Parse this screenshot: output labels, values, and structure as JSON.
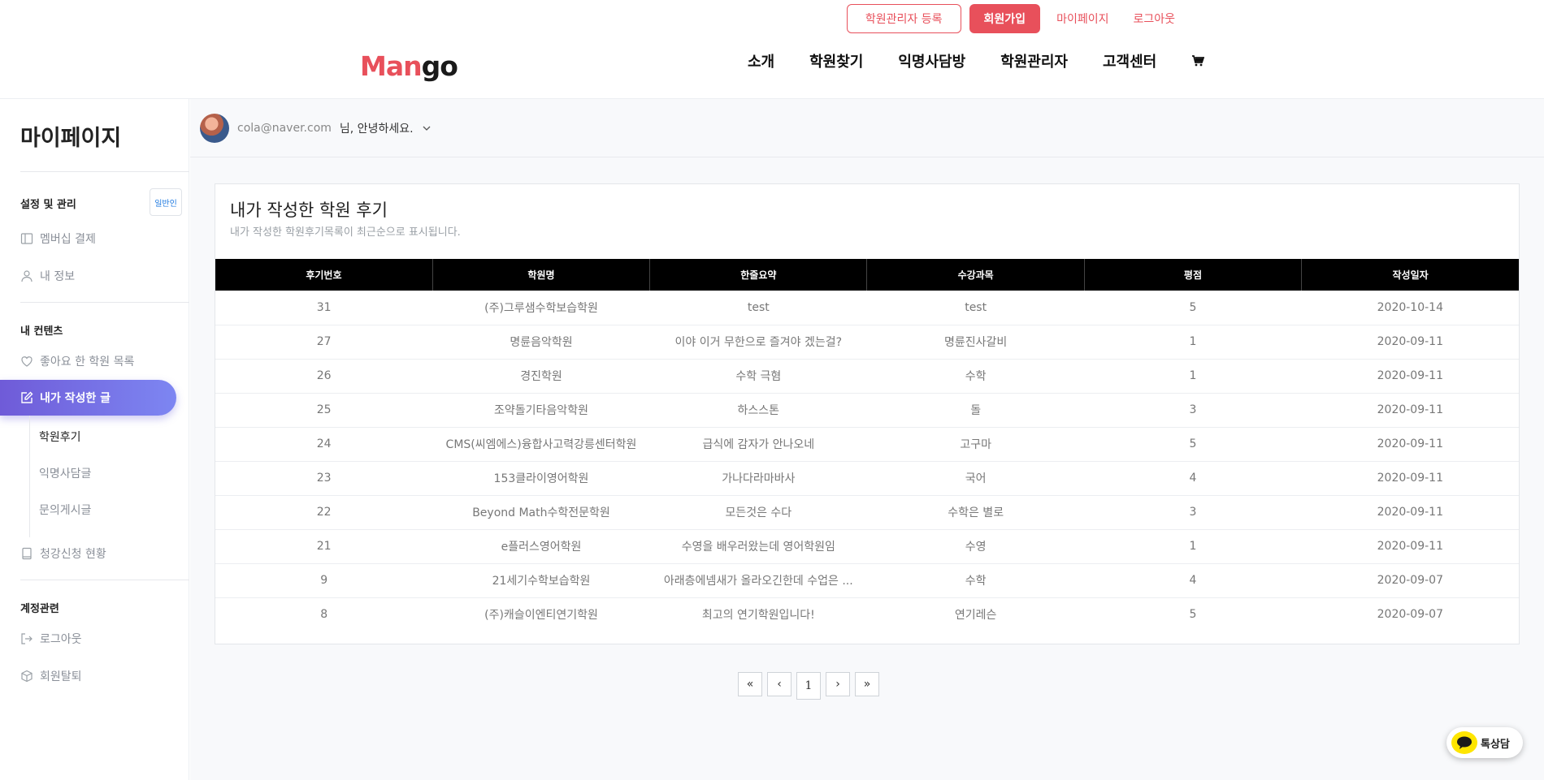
{
  "header": {
    "logo_part1": "Man",
    "logo_part2": "go",
    "top_links": {
      "admin_register": "학원관리자 등록",
      "signup": "회원가입",
      "mypage": "마이페이지",
      "logout": "로그아웃"
    },
    "nav": [
      "소개",
      "학원찾기",
      "익명사담방",
      "학원관리자",
      "고객센터"
    ],
    "cart_icon": "cart-icon"
  },
  "sidebar": {
    "title": "마이페이지",
    "section_settings": "설정 및 관리",
    "badge": "일반인",
    "membership": "멤버십 결제",
    "my_info": "내 정보",
    "section_content": "내 컨텐츠",
    "liked": "좋아요 한 학원 목록",
    "my_posts": "내가 작성한 글",
    "sub_reviews": "학원후기",
    "sub_anon": "익명사담글",
    "sub_inquiry": "문의게시글",
    "enrollment": "청강신청 현황",
    "section_account": "계정관련",
    "logout": "로그아웃",
    "withdraw": "회원탈퇴"
  },
  "userbar": {
    "email": "cola@naver.com",
    "greeting": "님, 안녕하세요."
  },
  "card": {
    "title": "내가 작성한 학원 후기",
    "subtitle": "내가 작성한 학원후기목록이 최근순으로 표시됩니다.",
    "columns": [
      "후기번호",
      "학원명",
      "한줄요약",
      "수강과목",
      "평점",
      "작성일자"
    ],
    "rows": [
      [
        "31",
        "(주)그루샘수학보습학원",
        "test",
        "test",
        "5",
        "2020-10-14"
      ],
      [
        "27",
        "명륜음악학원",
        "이야 이거 무한으로 즐겨야 겠는걸?",
        "명륜진사갈비",
        "1",
        "2020-09-11"
      ],
      [
        "26",
        "경진학원",
        "수학 극혐",
        "수학",
        "1",
        "2020-09-11"
      ],
      [
        "25",
        "조약돌기타음악학원",
        "하스스톤",
        "돌",
        "3",
        "2020-09-11"
      ],
      [
        "24",
        "CMS(씨엠에스)융합사고력강릉센터학원",
        "급식에 감자가 안나오네",
        "고구마",
        "5",
        "2020-09-11"
      ],
      [
        "23",
        "153클라이영어학원",
        "가나다라마바사",
        "국어",
        "4",
        "2020-09-11"
      ],
      [
        "22",
        "Beyond Math수학전문학원",
        "모든것은 수다",
        "수학은 별로",
        "3",
        "2020-09-11"
      ],
      [
        "21",
        "e플러스영어학원",
        "수영을 배우러왔는데 영어학원임",
        "수영",
        "1",
        "2020-09-11"
      ],
      [
        "9",
        "21세기수학보습학원",
        "아래층에넴새가 올라오긴한데 수업은 ...",
        "수학",
        "4",
        "2020-09-07"
      ],
      [
        "8",
        "(주)캐슬이엔티연기학원",
        "최고의 연기학원입니다!",
        "연기레슨",
        "5",
        "2020-09-07"
      ]
    ]
  },
  "pagination": {
    "first": "«",
    "prev": "‹",
    "current": "1",
    "next": "›",
    "last": "»"
  },
  "chat": {
    "label": "톡상담"
  },
  "colors": {
    "brand": "#e8505b",
    "active_gradient_start": "#6f5bd8",
    "active_gradient_end": "#7d86f2",
    "table_header": "#000000"
  }
}
